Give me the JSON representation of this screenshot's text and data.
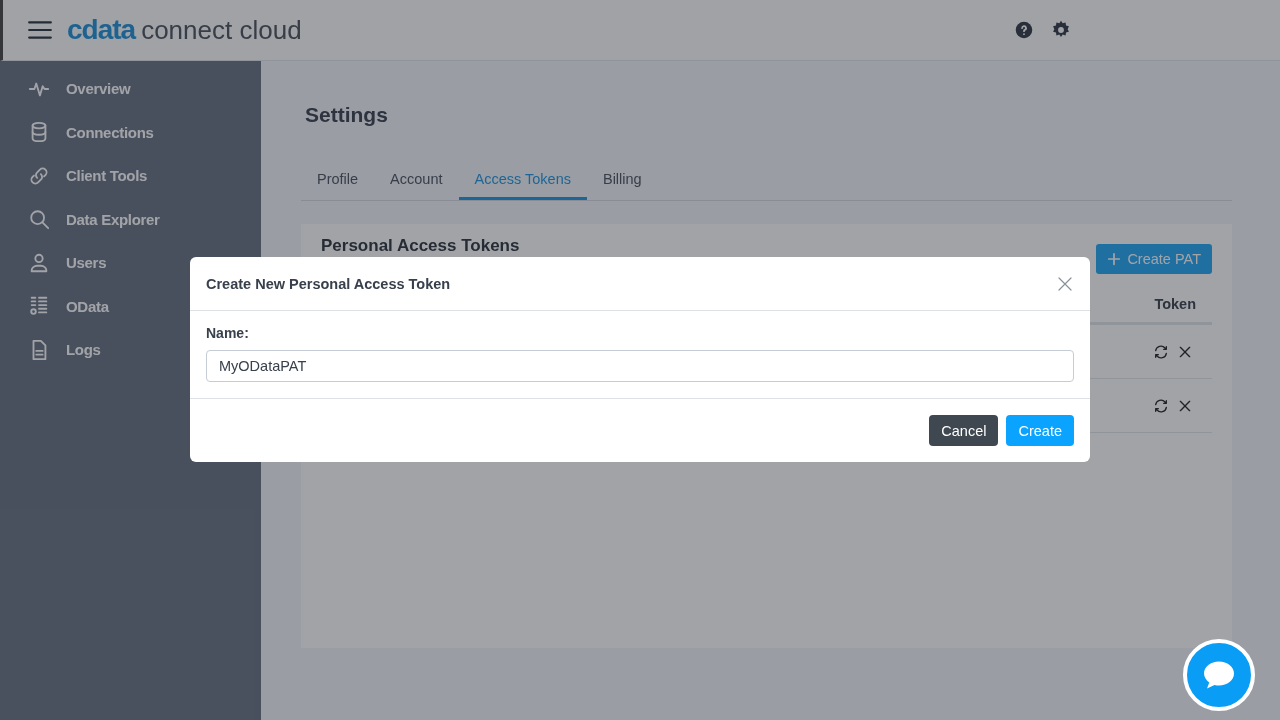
{
  "header": {
    "logo_mark": "cdata",
    "logo_text": "connect cloud"
  },
  "sidebar": {
    "items": [
      {
        "label": "Overview",
        "kind": "pulse"
      },
      {
        "label": "Connections",
        "kind": "database"
      },
      {
        "label": "Client Tools",
        "kind": "link"
      },
      {
        "label": "Data Explorer",
        "kind": "search"
      },
      {
        "label": "Users",
        "kind": "user"
      },
      {
        "label": "OData",
        "kind": "list"
      },
      {
        "label": "Logs",
        "kind": "file"
      }
    ]
  },
  "page": {
    "title": "Settings",
    "tabs": [
      {
        "label": "Profile",
        "selected": false
      },
      {
        "label": "Account",
        "selected": false
      },
      {
        "label": "Access Tokens",
        "selected": true
      },
      {
        "label": "Billing",
        "selected": false
      }
    ],
    "card": {
      "title": "Personal Access Tokens",
      "create_button": "Create PAT",
      "table": {
        "columns": [
          "Token"
        ],
        "rows": [
          {
            "kind": "token"
          },
          {
            "kind": "token"
          }
        ]
      }
    }
  },
  "dialog": {
    "title": "Create New Personal Access Token",
    "field_label": "Name:",
    "field_value": "MyODataPAT",
    "buttons": [
      {
        "label": "Cancel",
        "kind": "secondary"
      },
      {
        "label": "Create",
        "kind": "primary"
      }
    ]
  }
}
